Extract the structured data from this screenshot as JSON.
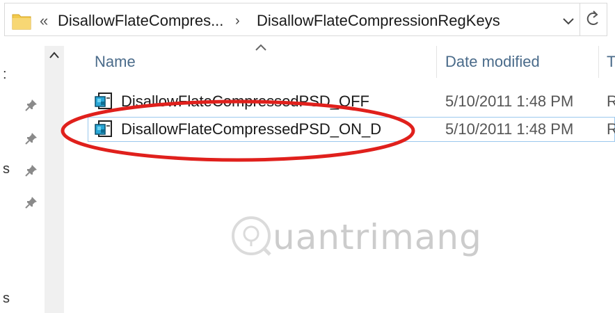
{
  "address_bar": {
    "overflow_chevron": "«",
    "crumbs": [
      "DisallowFlateCompres...",
      "DisallowFlateCompressionRegKeys"
    ],
    "separator": "›",
    "dropdown_icon": "chevron-down-icon",
    "refresh_icon": "refresh-icon"
  },
  "nav_pane": {
    "fragments": [
      ":",
      "s",
      "s"
    ],
    "pin_icon": "pin-icon"
  },
  "columns": {
    "name": "Name",
    "date_modified": "Date modified",
    "type": "T"
  },
  "files": [
    {
      "name": "DisallowFlateCompressedPSD_OFF",
      "date": "5/10/2011 1:48 PM",
      "type": "R",
      "icon": "registry-file-icon"
    },
    {
      "name": "DisallowFlateCompressedPSD_ON_D",
      "date": "5/10/2011 1:48 PM",
      "type": "R",
      "icon": "registry-file-icon"
    }
  ],
  "colors": {
    "annotation": "#e0201c",
    "header_text": "#4a6b8a",
    "folder": "#f2c94c"
  }
}
